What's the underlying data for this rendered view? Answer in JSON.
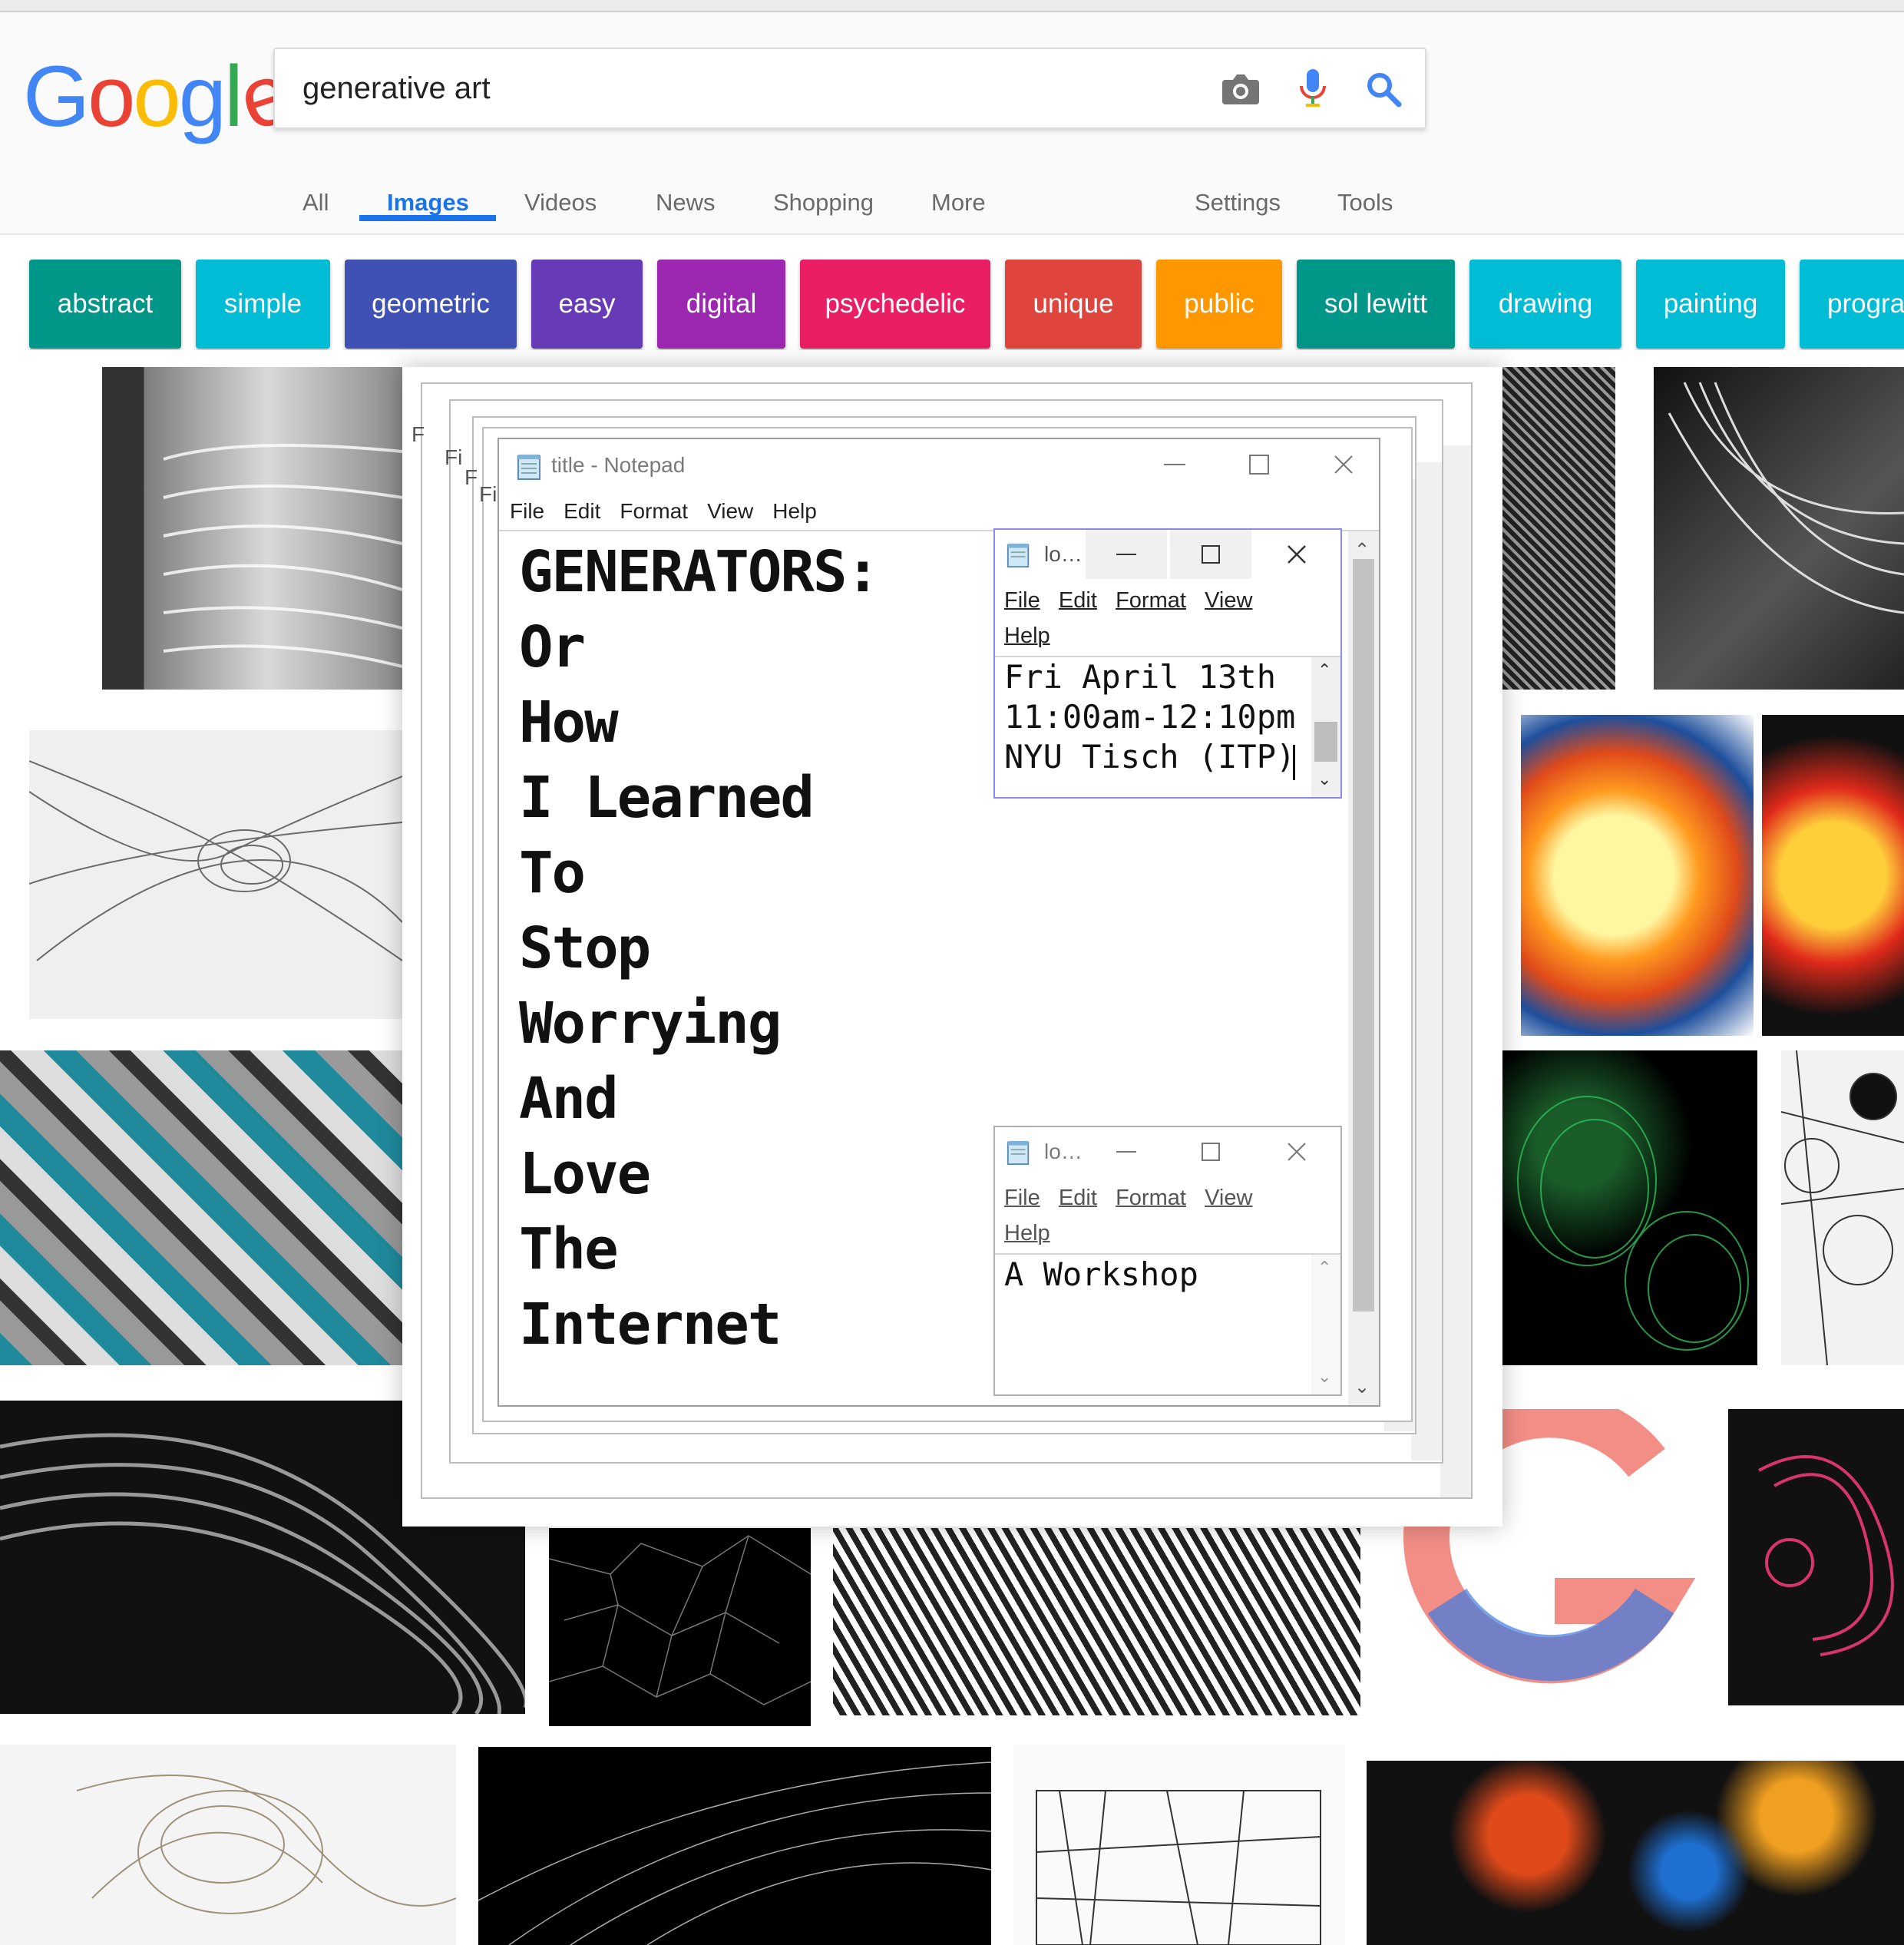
{
  "search": {
    "query": "generative art"
  },
  "logo": [
    "G",
    "o",
    "o",
    "g",
    "l",
    "e"
  ],
  "nav_tabs": [
    "All",
    "Images",
    "Videos",
    "News",
    "Shopping",
    "More"
  ],
  "nav_right": [
    "Settings",
    "Tools"
  ],
  "chips": [
    {
      "label": "abstract",
      "color": "#009688"
    },
    {
      "label": "simple",
      "color": "#00bcd4"
    },
    {
      "label": "geometric",
      "color": "#3f51b5"
    },
    {
      "label": "easy",
      "color": "#673ab7"
    },
    {
      "label": "digital",
      "color": "#9c27b0"
    },
    {
      "label": "psychedelic",
      "color": "#e91e63"
    },
    {
      "label": "unique",
      "color": "#e0453d"
    },
    {
      "label": "public",
      "color": "#ff9800"
    },
    {
      "label": "sol lewitt",
      "color": "#009688"
    },
    {
      "label": "drawing",
      "color": "#00bcd4"
    },
    {
      "label": "painting",
      "color": "#00bcd4"
    },
    {
      "label": "progra",
      "color": "#00bcd4"
    }
  ],
  "notepad_main": {
    "title": "title - Notepad",
    "menu": [
      "File",
      "Edit",
      "Format",
      "View",
      "Help"
    ],
    "content": "GENERATORS:\nOr\nHow\nI Learned\nTo\nStop\nWorrying\nAnd\nLove\nThe\nInternet",
    "behind_menu_fragment": "Fi",
    "behind_menu_fragment_2": "F"
  },
  "notepad_date": {
    "title": "lo…",
    "menu": [
      "File",
      "Edit",
      "Format",
      "View"
    ],
    "menu_row2": "Help",
    "content": "Fri April 13th\n11:00am-12:10pm\nNYU Tisch (ITP)"
  },
  "notepad_workshop": {
    "title": "lo…",
    "menu": [
      "File",
      "Edit",
      "Format",
      "View"
    ],
    "menu_row2": "Help",
    "content": "A Workshop"
  }
}
